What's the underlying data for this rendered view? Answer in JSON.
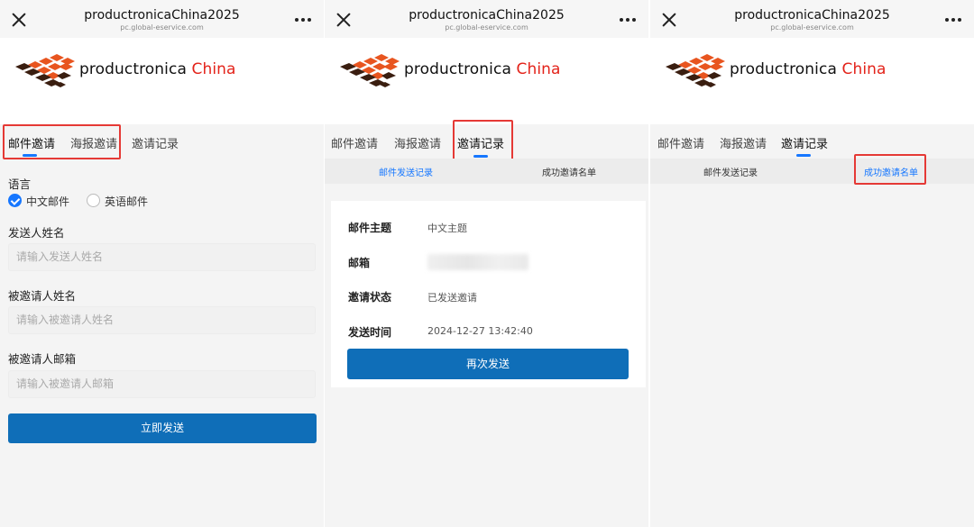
{
  "browser": {
    "title": "productronicaChina2025",
    "subtitle": "pc.global-eservice.com"
  },
  "logo": {
    "word": "productronica",
    "accent": "China",
    "accent_color": "#e3231a"
  },
  "tabs": {
    "mail": "邮件邀请",
    "poster": "海报邀请",
    "records": "邀请记录"
  },
  "form": {
    "language_label": "语言",
    "language_options": [
      "中文邮件",
      "英语邮件"
    ],
    "selected_language": "中文邮件",
    "sender_name_label": "发送人姓名",
    "sender_name_placeholder": "请输入发送人姓名",
    "invitee_name_label": "被邀请人姓名",
    "invitee_name_placeholder": "请输入被邀请人姓名",
    "invitee_email_label": "被邀请人邮箱",
    "invitee_email_placeholder": "请输入被邀请人邮箱",
    "send_button": "立即发送"
  },
  "records": {
    "subtabs": {
      "sent": "邮件发送记录",
      "success": "成功邀请名单"
    },
    "card": {
      "subject_label": "邮件主题",
      "subject_value": "中文主题",
      "email_label": "邮箱",
      "status_label": "邀请状态",
      "status_value": "已发送邀请",
      "time_label": "发送时间",
      "time_value": "2024-12-27 13:42:40",
      "resend_button": "再次发送"
    }
  },
  "colors": {
    "accent_blue": "#1677ff",
    "button_blue": "#0f6eb8",
    "highlight_red": "#e53935"
  },
  "icons": {
    "close": "close-icon",
    "more": "more-icon",
    "check": "check-icon"
  }
}
